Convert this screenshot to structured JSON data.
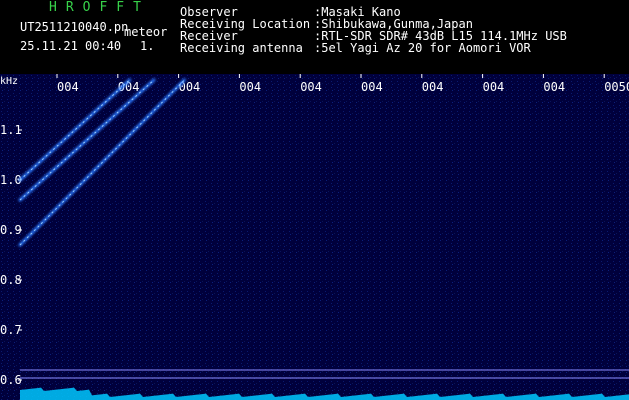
{
  "header": {
    "app_title": "HROFFT",
    "file_name": "UT2511210040.pn",
    "file_tag": "meteor",
    "date_time": "25.11.21 00:40",
    "count": "1.",
    "info": [
      {
        "label": "Observer",
        "value": ":Masaki Kano"
      },
      {
        "label": "Receiving Location",
        "value": ":Shibukawa,Gunma,Japan"
      },
      {
        "label": "Receiver",
        "value": ":RTL-SDR SDR# 43dB L15 114.1MHz USB"
      },
      {
        "label": "Receiving antenna",
        "value": ":5el Yagi Az 20 for Aomori VOR"
      }
    ]
  },
  "chart_data": {
    "type": "heatmap",
    "ylabel": "kHz",
    "ylim": [
      0.6,
      1.2
    ],
    "yticks": [
      "1.1",
      "1.0",
      "0.9",
      "0.8",
      "0.7",
      "0.6"
    ],
    "ytick_values": [
      1.1,
      1.0,
      0.9,
      0.8,
      0.7,
      0.6
    ],
    "xtick_labels": [
      "004",
      "004",
      "004",
      "004",
      "004",
      "004",
      "004",
      "004",
      "004",
      "0050"
    ],
    "colors": {
      "background": "#00003c",
      "signal": "#2a78ff",
      "grid": "#2a3a6a",
      "tick": "#ffffff",
      "spectrum": "#00c8ff"
    },
    "meteor_traces": [
      {
        "name": "",
        "points": [
          [
            0.0,
            0.87
          ],
          [
            0.27,
            1.2
          ]
        ]
      },
      {
        "name": "",
        "points": [
          [
            0.0,
            0.96
          ],
          [
            0.22,
            1.2
          ]
        ]
      },
      {
        "name": "",
        "points": [
          [
            0.0,
            1.0
          ],
          [
            0.18,
            1.2
          ]
        ]
      }
    ]
  }
}
